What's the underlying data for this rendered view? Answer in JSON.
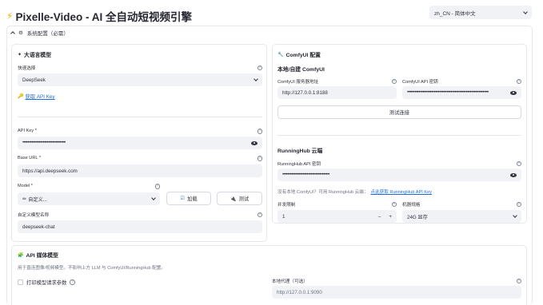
{
  "header": {
    "title": "Pixelle-Video - AI 全自动短视频引擎",
    "language_value": "zh_CN - 简体中文"
  },
  "expander": {
    "title": "系统配置（必需）"
  },
  "llm": {
    "title": "大语言模型",
    "quick_select_label": "快速选择",
    "quick_select_value": "DeepSeek",
    "get_key_link": "获取 API Key",
    "api_key_label": "API Key *",
    "api_key_value": "••••••••••••••••••••••••••••••••••",
    "base_url_label": "Base URL *",
    "base_url_value": "https://api.deepseek.com",
    "model_label": "Model *",
    "model_value": "自定义...",
    "load_button": "加载",
    "test_button": "测试",
    "custom_model_label": "自定义模型名称",
    "custom_model_value": "deepseek-chat"
  },
  "comfy": {
    "title": "ComfyUI 配置",
    "local_title": "本地/自建 ComfyUI",
    "server_label": "ComfyUI 服务器地址",
    "server_value": "http://127.0.0.1:8188",
    "key_label": "ComfyUI API 密钥",
    "key_value": "••••••••••••••••••••••••••••••••••••••••••••••••••••••••••••••••",
    "test_connection": "测试连接",
    "runninghub_title": "RunningHub 云端",
    "rh_key_label": "RunningHub API 密钥",
    "rh_key_value": "•••••••••••••••••••••••••••••••••••••",
    "no_local_text": "没有本地 ComfyUI？可用 RunningHub 云端：",
    "rh_link": "点此获取 RunningHub API Key",
    "concurrency_label": "并发限制",
    "concurrency_value": "1",
    "minus": "–",
    "plus": "+",
    "machine_label": "机器规格",
    "machine_value": "24G 显存"
  },
  "media": {
    "title": "API 媒体模型",
    "description": "用于直连图像/视频模型。不影响上方 LLM 与 ComfyUI/RunningHub 配置。",
    "print_params_label": "打印模型请求参数",
    "proxy_label": "本地代理（可选）",
    "proxy_placeholder": "http://127.0.0.1:9090"
  },
  "icons": {
    "help": "?",
    "bolt": "⚡",
    "gear": "⚙",
    "llm": "✦",
    "wrench": "🔧",
    "key": "🔑",
    "pencil": "✏",
    "load": "☑",
    "test": "🔌",
    "media": "🧩"
  }
}
